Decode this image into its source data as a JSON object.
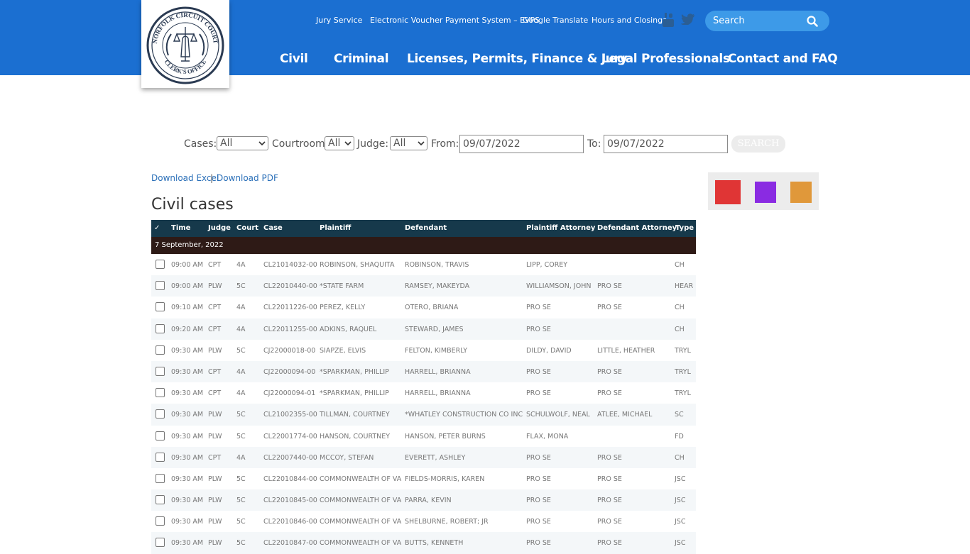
{
  "header": {
    "logo_alt": "NORFOLK CIRCUIT COURT CLERK'S OFFICE",
    "utility_links": [
      "Jury Service",
      "Electronic Voucher Payment System – EVPS",
      "Google Translate",
      "Hours and Closings"
    ],
    "search_placeholder": "Search",
    "nav": [
      "Civil",
      "Criminal",
      "Licenses, Permits, Finance & Jury",
      "Legal Professionals",
      "Contact and FAQ"
    ],
    "colors": {
      "bar": "#1b6fd1",
      "search_bg": "#3d9ae8"
    }
  },
  "filters": {
    "cases_label": "Cases:",
    "cases_value": "All",
    "courtroom_label": "Courtroom:",
    "courtroom_value": "All",
    "judge_label": "Judge:",
    "judge_value": "All",
    "from_label": "From:",
    "from_value": "09/07/2022",
    "to_label": "To:",
    "to_value": "09/07/2022",
    "search_button": "SEARCH"
  },
  "downloads": {
    "excel": "Download Excel",
    "separator": "|",
    "pdf": "Download PDF"
  },
  "page_title": "Civil cases",
  "table": {
    "headers": [
      "✓",
      "Time",
      "Judge",
      "Court",
      "Case",
      "Plaintiff",
      "Defendant",
      "Plaintiff Attorney",
      "Defendant Attorney",
      "Type"
    ],
    "group_label": "7 September, 2022",
    "rows": [
      [
        "09:00 AM",
        "CPT",
        "4A",
        "CL21014032-00",
        "ROBINSON, SHAQUITA",
        "ROBINSON, TRAVIS",
        "LIPP, COREY",
        "",
        "CH"
      ],
      [
        "09:00 AM",
        "PLW",
        "5C",
        "CL22010440-00",
        "*STATE FARM",
        "RAMSEY, MAKEYDA",
        "WILLIAMSON, JOHN",
        "PRO SE",
        "HEAR"
      ],
      [
        "09:10 AM",
        "CPT",
        "4A",
        "CL22011226-00",
        "PEREZ, KELLY",
        "OTERO, BRIANA",
        "PRO SE",
        "PRO SE",
        "CH"
      ],
      [
        "09:20 AM",
        "CPT",
        "4A",
        "CL22011255-00",
        "ADKINS, RAQUEL",
        "STEWARD, JAMES",
        "PRO SE",
        "",
        "CH"
      ],
      [
        "09:30 AM",
        "PLW",
        "5C",
        "CJ22000018-00",
        "SIAPZE, ELVIS",
        "FELTON, KIMBERLY",
        "DILDY, DAVID",
        "LITTLE, HEATHER",
        "TRYL"
      ],
      [
        "09:30 AM",
        "CPT",
        "4A",
        "CJ22000094-00",
        "*SPARKMAN, PHILLIP",
        "HARRELL, BRIANNA",
        "PRO SE",
        "PRO SE",
        "TRYL"
      ],
      [
        "09:30 AM",
        "CPT",
        "4A",
        "CJ22000094-01",
        "*SPARKMAN, PHILLIP",
        "HARRELL, BRIANNA",
        "PRO SE",
        "PRO SE",
        "TRYL"
      ],
      [
        "09:30 AM",
        "PLW",
        "5C",
        "CL21002355-00",
        "TILLMAN, COURTNEY",
        "*WHATLEY CONSTRUCTION CO INC",
        "SCHULWOLF, NEAL",
        "ATLEE, MICHAEL",
        "SC"
      ],
      [
        "09:30 AM",
        "PLW",
        "5C",
        "CL22001774-00",
        "HANSON, COURTNEY",
        "HANSON, PETER BURNS",
        "FLAX, MONA",
        "",
        "FD"
      ],
      [
        "09:30 AM",
        "CPT",
        "4A",
        "CL22007440-00",
        "MCCOY, STEFAN",
        "EVERETT, ASHLEY",
        "PRO SE",
        "PRO SE",
        "CH"
      ],
      [
        "09:30 AM",
        "PLW",
        "5C",
        "CL22010844-00",
        "COMMONWEALTH OF VA",
        "FIELDS-MORRIS, KAREN",
        "PRO SE",
        "PRO SE",
        "JSC"
      ],
      [
        "09:30 AM",
        "PLW",
        "5C",
        "CL22010845-00",
        "COMMONWEALTH OF VA",
        "PARRA, KEVIN",
        "PRO SE",
        "PRO SE",
        "JSC"
      ],
      [
        "09:30 AM",
        "PLW",
        "5C",
        "CL22010846-00",
        "COMMONWEALTH OF VA",
        "SHELBURNE, ROBERT; JR",
        "PRO SE",
        "PRO SE",
        "JSC"
      ],
      [
        "09:30 AM",
        "PLW",
        "5C",
        "CL22010847-00",
        "COMMONWEALTH OF VA",
        "BUTTS, KENNETH",
        "PRO SE",
        "PRO SE",
        "JSC"
      ]
    ]
  },
  "legend_colors": [
    "#e03535",
    "#8a2be2",
    "#e0983a"
  ]
}
